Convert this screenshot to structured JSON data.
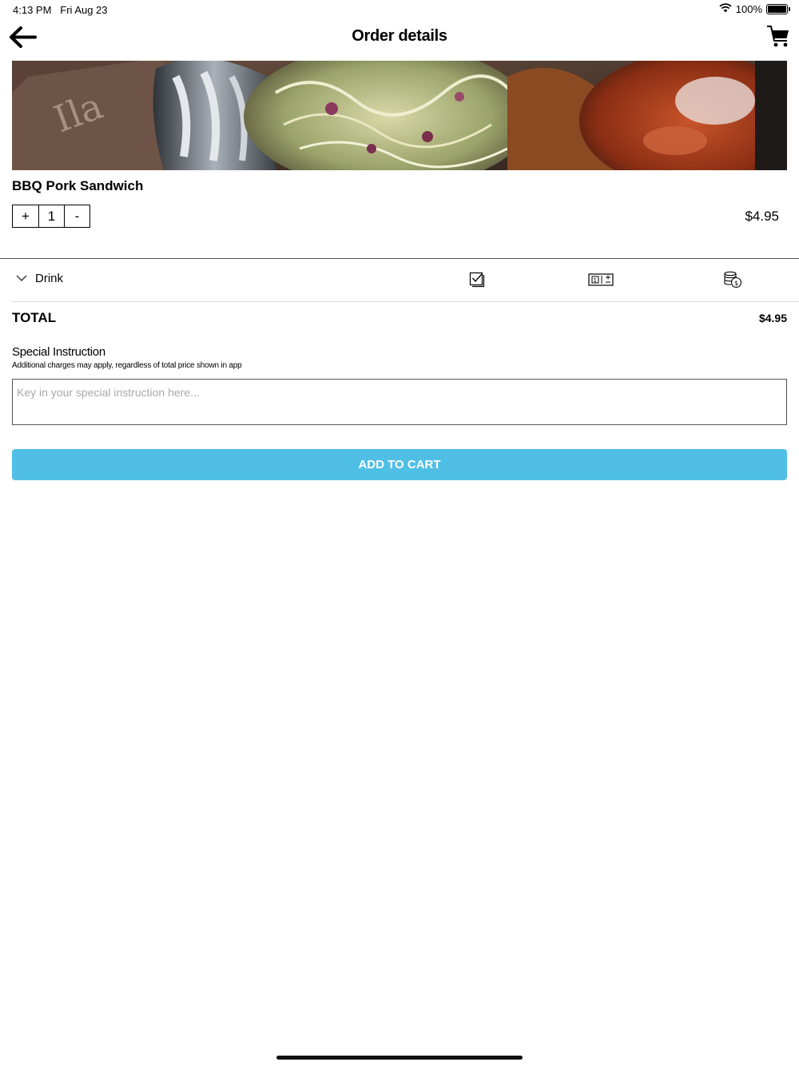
{
  "status_bar": {
    "time": "4:13 PM",
    "date": "Fri Aug 23",
    "battery_text": "100%",
    "battery_level": 1.0
  },
  "nav": {
    "title": "Order details",
    "back_icon": "arrow-left-icon",
    "cart_icon": "cart-icon"
  },
  "item": {
    "name": "BBQ Pork Sandwich",
    "qty_plus": "+",
    "quantity": "1",
    "qty_minus": "-",
    "price": "$4.95"
  },
  "options": [
    {
      "label": "Drink",
      "icons": [
        "chevron-down-icon",
        "checkbox-select-icon",
        "quantity-select-icon",
        "price-coins-icon"
      ]
    }
  ],
  "total": {
    "label": "TOTAL",
    "value": "$4.95"
  },
  "special_instruction": {
    "title": "Special Instruction",
    "note": "Additional charges may apply, regardless of total price shown in app",
    "placeholder": "Key in your special instruction here...",
    "value": ""
  },
  "actions": {
    "add_to_cart": "ADD TO CART"
  },
  "colors": {
    "accent": "#4fbfe6",
    "text": "#000000",
    "placeholder": "#a8a8a8",
    "divider": "#dcdcdc"
  }
}
